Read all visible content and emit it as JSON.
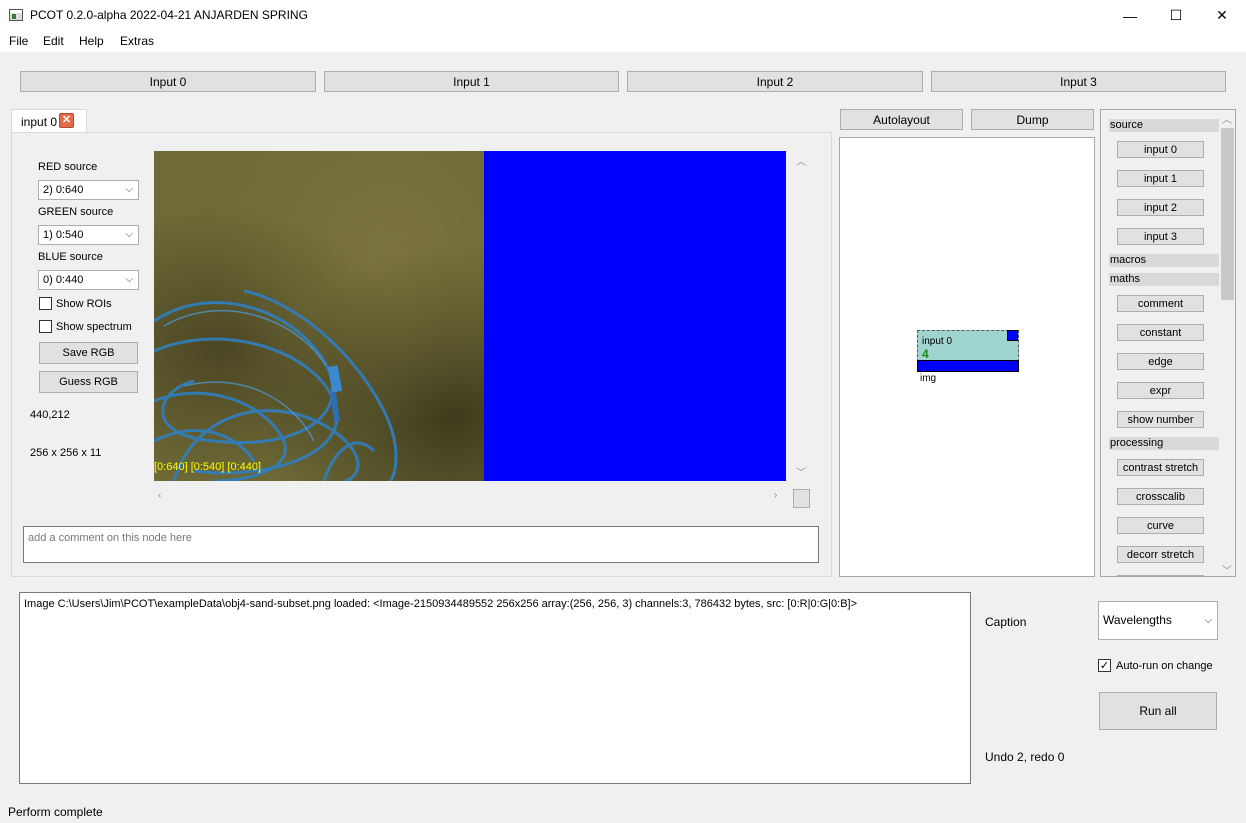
{
  "window": {
    "title": "PCOT 0.2.0-alpha 2022-04-21 ANJARDEN SPRING",
    "minimize_glyph": "—",
    "maximize_glyph": "☐",
    "close_glyph": "✕"
  },
  "menu": [
    "File",
    "Edit",
    "Help",
    "Extras"
  ],
  "inputs": [
    "Input 0",
    "Input 1",
    "Input 2",
    "Input 3"
  ],
  "tab": {
    "label": "input 0",
    "close_glyph": "✕"
  },
  "controls": {
    "red_label": "RED source",
    "red_value": "2) 0:640",
    "green_label": "GREEN source",
    "green_value": "1) 0:540",
    "blue_label": "BLUE source",
    "blue_value": "0) 0:440",
    "show_rois": "Show ROIs",
    "show_spectrum": "Show spectrum",
    "save_rgb": "Save RGB",
    "guess_rgb": "Guess RGB",
    "coords": "440,212",
    "dims": "256 x 256 x 11"
  },
  "image": {
    "caption": "[0:640] [0:540] [0:440]"
  },
  "comment": {
    "placeholder": "add a comment on this node here"
  },
  "graph": {
    "autolayout": "Autolayout",
    "dump": "Dump",
    "node_title": "input 0",
    "node_count": "4",
    "node_output": "img"
  },
  "palette": {
    "source_header": "source",
    "source_items": [
      "input 0",
      "input 1",
      "input 2",
      "input 3"
    ],
    "macros_header": "macros",
    "maths_header": "maths",
    "maths_items": [
      "comment",
      "constant",
      "edge",
      "expr",
      "show number"
    ],
    "processing_header": "processing",
    "processing_items": [
      "contrast stretch",
      "crosscalib",
      "curve",
      "decorr stretch"
    ]
  },
  "log": {
    "text": "Image C:\\Users\\Jim\\PCOT\\exampleData\\obj4-sand-subset.png loaded: <Image-2150934489552 256x256 array:(256, 256, 3) channels:3, 786432 bytes, src: [0:R|0:G|0:B]>"
  },
  "side": {
    "caption_label": "Caption",
    "caption_value": "Wavelengths",
    "autorun_label": "Auto-run on change",
    "autorun_checked": true,
    "run_all": "Run all",
    "undo_redo": "Undo 2, redo 0"
  },
  "status": "Perform complete"
}
